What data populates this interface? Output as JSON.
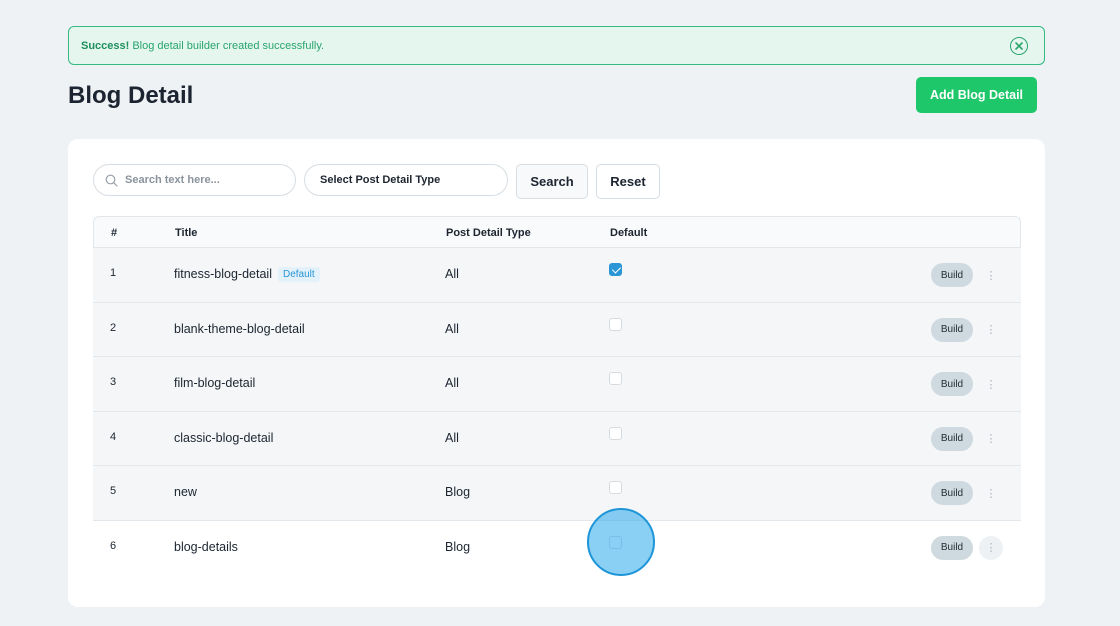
{
  "alert": {
    "title": "Success!",
    "message": "Blog detail builder created successfully."
  },
  "header": {
    "title": "Blog Detail",
    "add_button": "Add Blog Detail"
  },
  "filters": {
    "search_placeholder": "Search text here...",
    "type_select": "Select Post Detail Type",
    "search_button": "Search",
    "reset_button": "Reset"
  },
  "table": {
    "columns": [
      "#",
      "Title",
      "Post Detail Type",
      "Default"
    ],
    "rows": [
      {
        "num": "1",
        "title": "fitness-blog-detail",
        "badge": "Default",
        "type": "All",
        "default": true,
        "build": "Build"
      },
      {
        "num": "2",
        "title": "blank-theme-blog-detail",
        "badge": "",
        "type": "All",
        "default": false,
        "build": "Build"
      },
      {
        "num": "3",
        "title": "film-blog-detail",
        "badge": "",
        "type": "All",
        "default": false,
        "build": "Build"
      },
      {
        "num": "4",
        "title": "classic-blog-detail",
        "badge": "",
        "type": "All",
        "default": false,
        "build": "Build"
      },
      {
        "num": "5",
        "title": "new",
        "badge": "",
        "type": "Blog",
        "default": false,
        "build": "Build"
      },
      {
        "num": "6",
        "title": "blog-details",
        "badge": "",
        "type": "Blog",
        "default": false,
        "build": "Build"
      }
    ]
  },
  "colors": {
    "success": "#1ec76a",
    "accent": "#2a96d6"
  },
  "icons": {
    "alert_close": "close-circle-icon",
    "search": "search-icon",
    "more": "vertical-dots-icon"
  }
}
